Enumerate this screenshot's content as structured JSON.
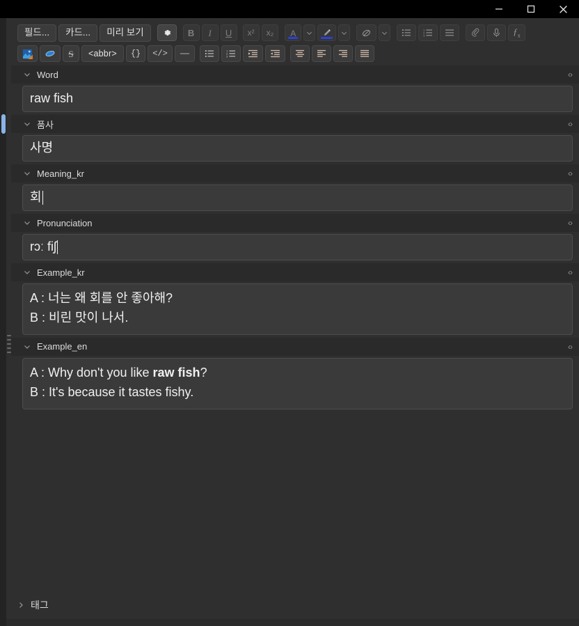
{
  "window": {
    "controls": [
      {
        "name": "minimize",
        "glyph": "minimize-icon"
      },
      {
        "name": "maximize",
        "glyph": "maximize-icon"
      },
      {
        "name": "close",
        "glyph": "close-icon"
      }
    ]
  },
  "toolbar": {
    "row1": {
      "fields_button": "필드...",
      "cards_button": "카드...",
      "preview_button": "미리 보기",
      "settings_icon": "gear-icon",
      "bold": "B",
      "italic": "I",
      "underline": "U",
      "superscript": "x²",
      "subscript": "x₂",
      "text_color": "A",
      "text_color_hex": "#2b41d8",
      "highlight_color_hex": "#2b41d8",
      "highlight_icon": "marker-pen-icon",
      "color_dropdown_icon": "chevron-down-icon",
      "remove_format_icon": "eraser-icon",
      "remove_format_dropdown_icon": "chevron-down-icon",
      "unordered_list_icon": "bullet-list-icon",
      "ordered_list_icon": "numbered-list-icon",
      "justify_icon": "align-justify-icon",
      "attachment_icon": "paperclip-icon",
      "record_icon": "microphone-icon",
      "equation_icon": "function-fx-icon"
    },
    "row2": {
      "image_occlusion_icon": "image-edit-icon",
      "cloze_icon": "blue-ellipse-icon",
      "strikethrough": "S",
      "abbr_button": "<abbr>",
      "braces_button": "{}",
      "code_button": "</>",
      "hrule_icon": "horizontal-rule-icon",
      "bullet_list_icon": "bullet-list-icon",
      "number_list_icon": "numbered-list-icon",
      "indent_icon": "indent-icon",
      "outdent_icon": "outdent-icon",
      "align_center_icon": "align-center-icon",
      "align_left_icon": "align-left-icon",
      "align_right_icon": "align-right-icon",
      "align_justify_icon": "align-justify-icon"
    }
  },
  "fields": [
    {
      "name": "Word",
      "value": "raw fish",
      "multiline": false,
      "collapse_icon": "chevron-down-icon",
      "html_icon": "html-editor-icon"
    },
    {
      "name": "품사",
      "value": "사명",
      "multiline": false,
      "collapse_icon": "chevron-down-icon",
      "html_icon": "html-editor-icon"
    },
    {
      "name": "Meaning_kr",
      "value": "회",
      "multiline": false,
      "caret": true,
      "collapse_icon": "chevron-down-icon",
      "html_icon": "html-editor-icon"
    },
    {
      "name": "Pronunciation",
      "value": "rɔː fiʃ",
      "multiline": false,
      "caret": true,
      "collapse_icon": "chevron-down-icon",
      "html_icon": "html-editor-icon"
    },
    {
      "name": "Example_kr",
      "multiline": true,
      "lines": [
        "A : 너는 왜 회를 안 좋아해?",
        "B : 비린 맛이 나서."
      ],
      "collapse_icon": "chevron-down-icon",
      "html_icon": "html-editor-icon"
    },
    {
      "name": "Example_en",
      "multiline": true,
      "lines_html": [
        "A : Why don't you like <b>raw fish</b>?",
        "B : It's because it tastes fishy."
      ],
      "collapse_icon": "chevron-down-icon",
      "html_icon": "html-editor-icon"
    }
  ],
  "tags": {
    "label": "태그",
    "expand_icon": "chevron-right-icon"
  }
}
